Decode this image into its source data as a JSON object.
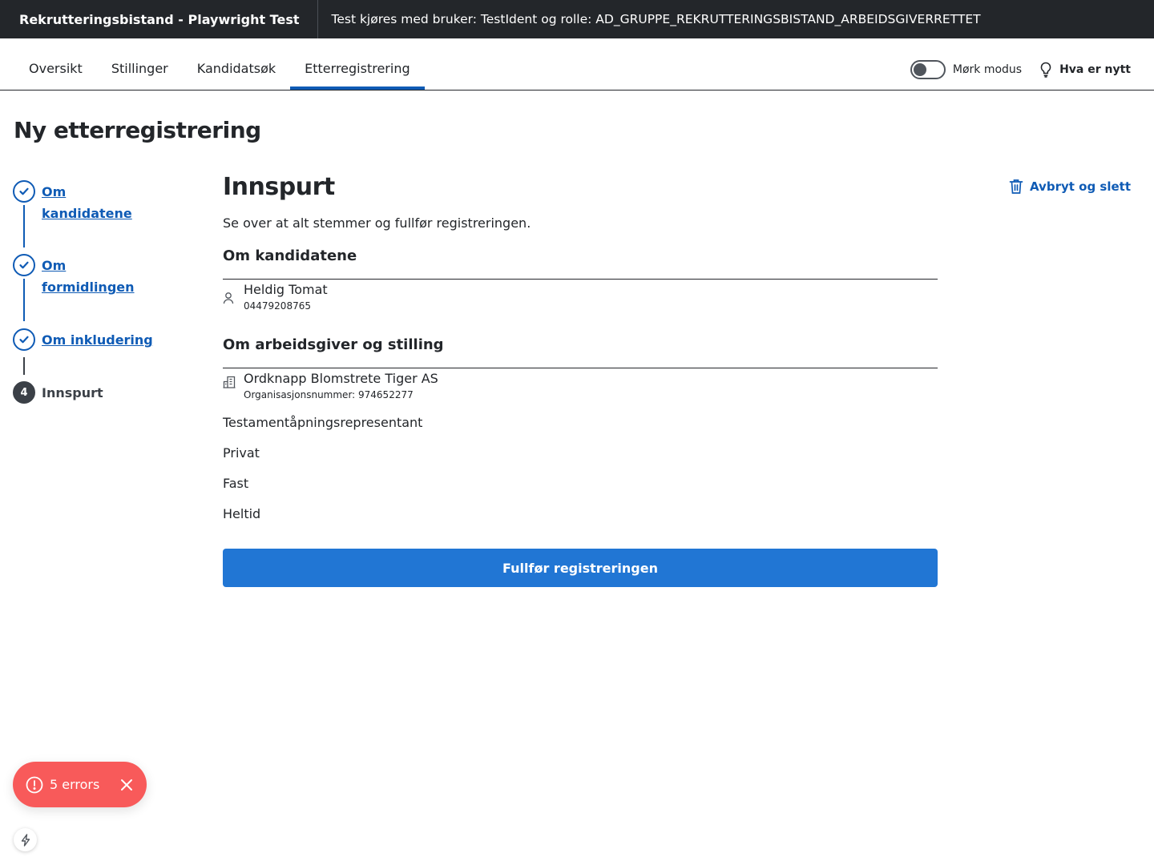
{
  "topbar": {
    "app_title": "Rekrutteringsbistand - Playwright Test",
    "test_info": "Test kjøres med bruker: TestIdent og rolle: AD_GRUPPE_REKRUTTERINGSBISTAND_ARBEIDSGIVERRETTET"
  },
  "nav": {
    "tabs": [
      {
        "label": "Oversikt",
        "active": false
      },
      {
        "label": "Stillinger",
        "active": false
      },
      {
        "label": "Kandidatsøk",
        "active": false
      },
      {
        "label": "Etterregistrering",
        "active": true
      }
    ],
    "dark_mode_label": "Mørk modus",
    "dark_mode_on": false,
    "news_label": "Hva er nytt"
  },
  "page_title": "Ny etterregistrering",
  "stepper": {
    "steps": [
      {
        "line1": "Om",
        "line2": "kandidatene",
        "status": "done"
      },
      {
        "line1": "Om",
        "line2": "formidlingen",
        "status": "done"
      },
      {
        "line1": "Om inkludering",
        "line2": "",
        "status": "done"
      },
      {
        "number": "4",
        "line1": "Innspurt",
        "status": "current"
      }
    ]
  },
  "main": {
    "heading": "Innspurt",
    "intro": "Se over at alt stemmer og fullfør registreringen.",
    "candidates_title": "Om kandidatene",
    "candidate": {
      "name": "Heldig Tomat",
      "id": "04479208765"
    },
    "employer_title": "Om arbeidsgiver og stilling",
    "employer": {
      "name": "Ordknapp Blomstrete Tiger AS",
      "orgnr": "Organisasjonsnummer: 974652277"
    },
    "details": [
      "Testamentåpningsrepresentant",
      "Privat",
      "Fast",
      "Heltid"
    ],
    "submit_label": "Fullfør registreringen"
  },
  "cancel_label": "Avbryt og slett",
  "errors": {
    "label": "5 errors",
    "count": 5
  },
  "colors": {
    "accent": "#0f5bb5",
    "button": "#2176d4",
    "topbar": "#23262a",
    "error": "#f85a5a"
  },
  "icons": [
    "check-icon",
    "person-icon",
    "building-icon",
    "trash-icon",
    "lightbulb-icon",
    "alert-icon",
    "close-icon",
    "bolt-icon"
  ]
}
